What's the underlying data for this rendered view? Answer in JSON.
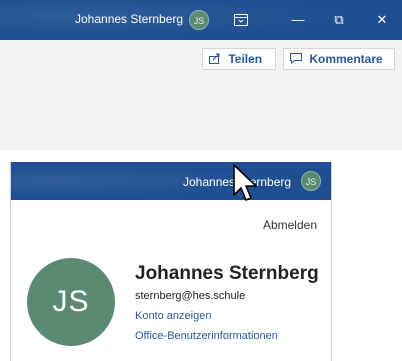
{
  "titlebar": {
    "user_name": "Johannes Sternberg",
    "avatar_initials": "JS",
    "minimize_glyph": "—",
    "restore_glyph": "⧉",
    "close_glyph": "✕"
  },
  "ribbon": {
    "share_label": "Teilen",
    "comments_label": "Kommentare"
  },
  "flyout": {
    "header_name": "Johannes Sternberg",
    "header_initials": "JS",
    "signout_label": "Abmelden",
    "avatar_initials": "JS",
    "account_name": "Johannes Sternberg",
    "account_email": "sternberg@hes.schule",
    "view_account_label": "Konto anzeigen",
    "office_info_label": "Office-Benutzerinformationen"
  },
  "colors": {
    "titlebar_blue": "#1f4f92",
    "avatar_green": "#5b8a72",
    "link_blue": "#2b579a"
  }
}
